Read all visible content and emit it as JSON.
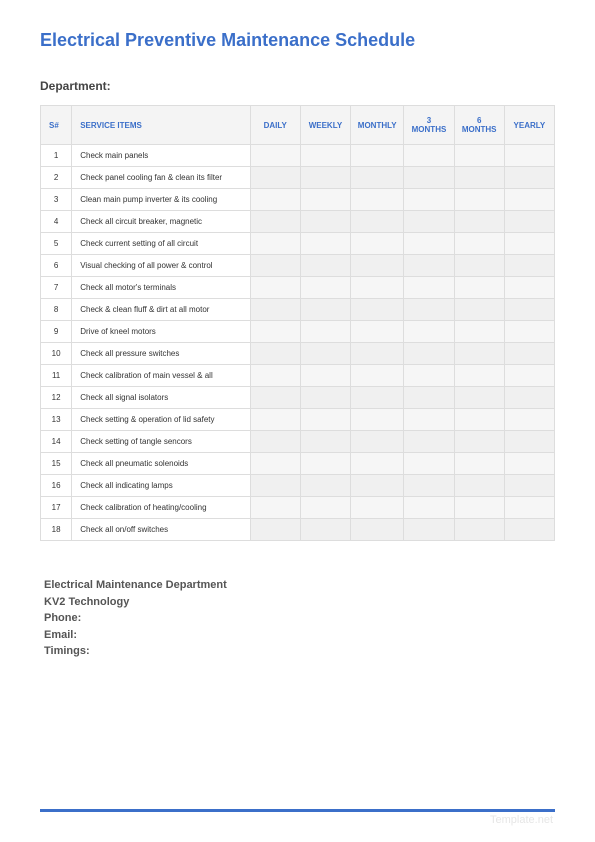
{
  "title": "Electrical Preventive Maintenance Schedule",
  "department_label": "Department:",
  "columns": {
    "sn": "S#",
    "service_items": "SERVICE ITEMS",
    "daily": "DAILY",
    "weekly": "WEEKLY",
    "monthly": "MONTHLY",
    "months3": "3 MONTHS",
    "months6": "6 MONTHS",
    "yearly": "YEARLY"
  },
  "rows": [
    {
      "n": "1",
      "item": "Check main panels"
    },
    {
      "n": "2",
      "item": "Check panel cooling fan & clean its filter"
    },
    {
      "n": "3",
      "item": "Clean main pump inverter & its cooling"
    },
    {
      "n": "4",
      "item": "Check all circuit breaker, magnetic"
    },
    {
      "n": "5",
      "item": "Check current setting of all circuit"
    },
    {
      "n": "6",
      "item": "Visual checking of all power & control"
    },
    {
      "n": "7",
      "item": "Check all motor's terminals"
    },
    {
      "n": "8",
      "item": "Check & clean fluff & dirt at all motor"
    },
    {
      "n": "9",
      "item": "Drive of kneel motors"
    },
    {
      "n": "10",
      "item": "Check all pressure switches"
    },
    {
      "n": "11",
      "item": "Check calibration of main vessel & all"
    },
    {
      "n": "12",
      "item": "Check all signal isolators"
    },
    {
      "n": "13",
      "item": "Check setting & operation of lid safety"
    },
    {
      "n": "14",
      "item": "Check setting of tangle sencors"
    },
    {
      "n": "15",
      "item": "Check all pneumatic solenoids"
    },
    {
      "n": "16",
      "item": "Check all indicating lamps"
    },
    {
      "n": "17",
      "item": "Check calibration of heating/cooling"
    },
    {
      "n": "18",
      "item": "Check all on/off switches"
    }
  ],
  "footer": {
    "dept_name": "Electrical Maintenance Department",
    "company": "KV2 Technology",
    "phone_label": "Phone:",
    "email_label": "Email:",
    "timings_label": "Timings:"
  },
  "watermark": "Template.net"
}
